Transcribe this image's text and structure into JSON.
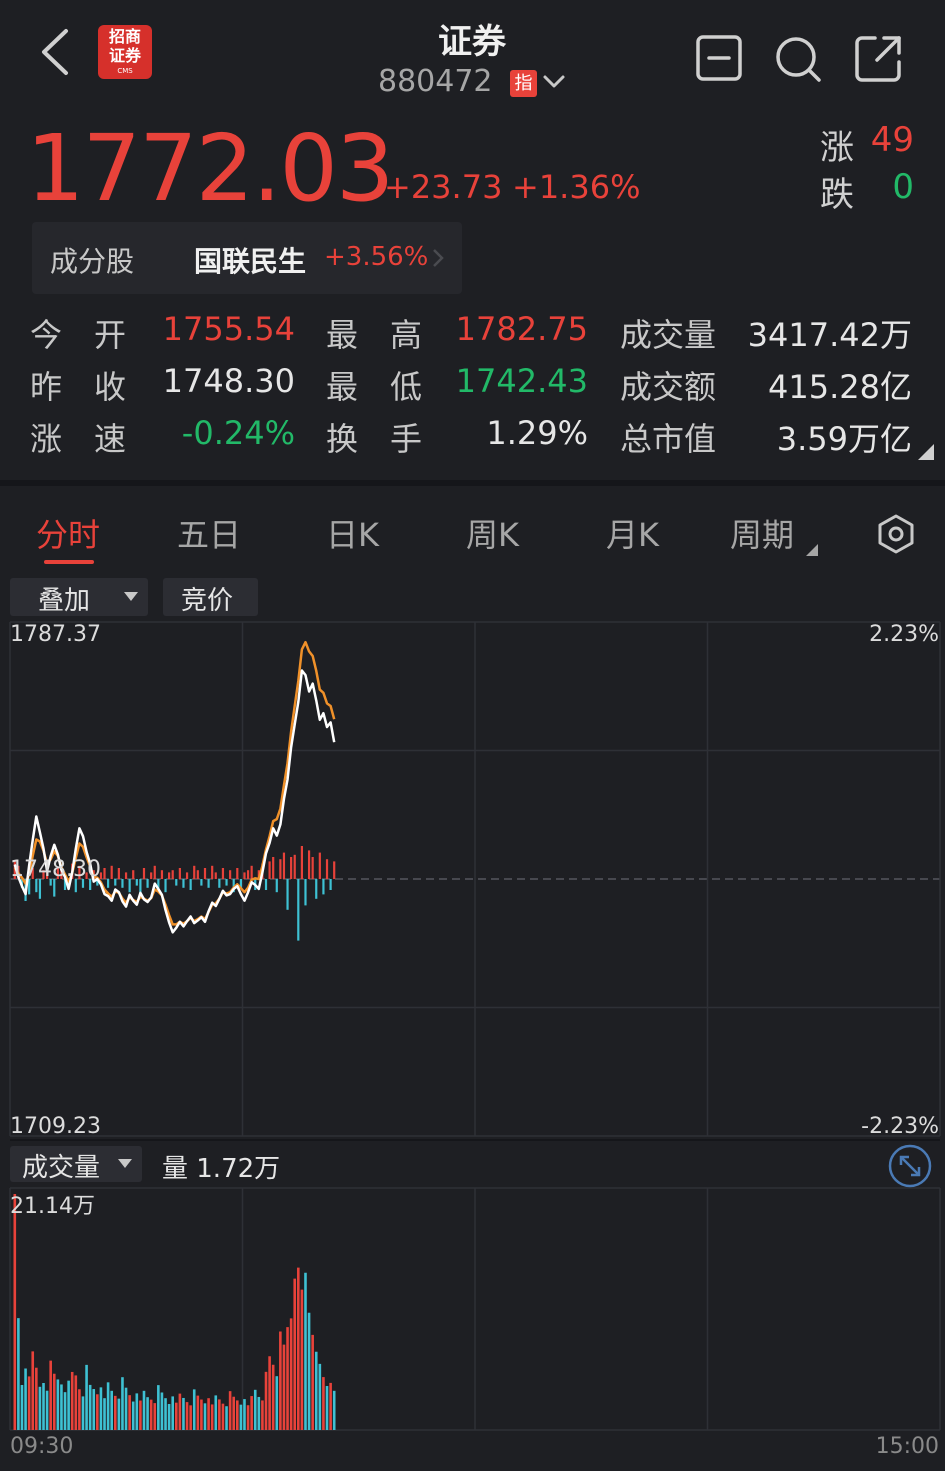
{
  "header": {
    "logo_line1": "招商",
    "logo_line2": "证券",
    "logo_line3": "CMS",
    "title": "证券",
    "code": "880472",
    "index_badge": "指"
  },
  "quote": {
    "price": "1772.03",
    "change": "+23.73",
    "change_pct": "+1.36%",
    "up_label": "涨",
    "up_count": "49",
    "down_label": "跌",
    "down_count": "0"
  },
  "constituent": {
    "label": "成分股",
    "name": "国联民生",
    "pct": "+3.56%"
  },
  "stats": {
    "open_label": "今　开",
    "open": "1755.54",
    "high_label": "最　高",
    "high": "1782.75",
    "volume_label": "成交量",
    "volume": "3417.42万",
    "prev_label": "昨　收",
    "prev": "1748.30",
    "low_label": "最　低",
    "low": "1742.43",
    "amount_label": "成交额",
    "amount": "415.28亿",
    "speed_label": "涨　速",
    "speed": "-0.24%",
    "turnover_label": "换　手",
    "turnover": "1.29%",
    "mktcap_label": "总市值",
    "mktcap": "3.59万亿"
  },
  "tabs": [
    "分时",
    "五日",
    "日K",
    "周K",
    "月K",
    "周期"
  ],
  "toolbar": {
    "overlay": "叠加",
    "auction": "竞价",
    "volume_selector": "成交量",
    "volume_value": "量 1.72万"
  },
  "colors": {
    "up": "#e8423a",
    "down": "#22b968",
    "price_line": "#ffffff",
    "avg_line": "#f0912a",
    "neg_bar": "#3ec1d3"
  },
  "chart_data": {
    "type": "line",
    "y_top": 1787.37,
    "y_bottom": 1709.23,
    "y_mid": 1748.3,
    "pct_top": "2.23%",
    "pct_bottom": "-2.23%",
    "y_top_label": "1787.37",
    "y_bottom_label": "1709.23",
    "y_mid_label": "1748.30",
    "x_start_label": "09:30",
    "x_end_label": "15:00",
    "total_points": 241,
    "price": [
      1750.5,
      1748.6,
      1747.2,
      1746.0,
      1750.3,
      1754.2,
      1757.8,
      1755.4,
      1752.9,
      1749.5,
      1751.8,
      1753.5,
      1752.0,
      1749.7,
      1748.6,
      1746.8,
      1749.3,
      1752.9,
      1756.0,
      1754.8,
      1752.4,
      1750.6,
      1747.9,
      1748.3,
      1747.5,
      1746.0,
      1745.7,
      1745.0,
      1746.7,
      1746.3,
      1744.9,
      1744.1,
      1745.9,
      1745.0,
      1744.4,
      1746.2,
      1745.2,
      1744.8,
      1745.5,
      1747.6,
      1746.8,
      1745.9,
      1743.6,
      1741.7,
      1740.2,
      1740.9,
      1741.8,
      1741.1,
      1741.9,
      1742.6,
      1741.6,
      1742.0,
      1742.5,
      1741.8,
      1743.4,
      1744.7,
      1744.2,
      1745.3,
      1746.5,
      1745.8,
      1746.0,
      1746.8,
      1747.2,
      1746.0,
      1745.0,
      1746.3,
      1747.8,
      1747.4,
      1746.8,
      1749.3,
      1752.2,
      1753.8,
      1756.0,
      1754.9,
      1756.6,
      1760.5,
      1763.4,
      1768.3,
      1771.8,
      1775.2,
      1780.0,
      1779.3,
      1776.8,
      1778.0,
      1775.4,
      1772.5,
      1773.5,
      1771.4,
      1772.1,
      1769.1
    ],
    "average": [
      1750.0,
      1749.2,
      1748.5,
      1747.6,
      1749.0,
      1751.8,
      1754.3,
      1754.0,
      1752.6,
      1750.6,
      1751.3,
      1752.5,
      1751.8,
      1750.1,
      1749.0,
      1747.9,
      1749.2,
      1751.5,
      1753.7,
      1753.2,
      1751.6,
      1750.2,
      1748.6,
      1748.5,
      1747.8,
      1746.7,
      1746.1,
      1745.6,
      1746.4,
      1746.2,
      1745.3,
      1744.7,
      1745.5,
      1745.1,
      1744.8,
      1745.6,
      1745.3,
      1745.0,
      1745.4,
      1746.7,
      1746.4,
      1745.8,
      1744.4,
      1742.8,
      1741.4,
      1741.4,
      1741.8,
      1741.5,
      1741.9,
      1742.4,
      1741.9,
      1742.2,
      1742.6,
      1742.2,
      1743.3,
      1744.4,
      1744.6,
      1745.3,
      1746.3,
      1746.1,
      1746.3,
      1747.0,
      1747.5,
      1746.9,
      1746.3,
      1747.0,
      1748.2,
      1748.4,
      1748.3,
      1750.3,
      1752.8,
      1754.8,
      1757.1,
      1757.4,
      1759.0,
      1762.6,
      1765.9,
      1770.7,
      1774.6,
      1778.4,
      1783.2,
      1784.3,
      1782.9,
      1782.2,
      1779.9,
      1777.1,
      1776.6,
      1775.0,
      1774.6,
      1772.6
    ],
    "trend_bars": [
      8,
      6,
      -4,
      -10,
      -7,
      5,
      -6,
      -9,
      4,
      7,
      -3,
      -8,
      5,
      6,
      -5,
      -4,
      7,
      -6,
      6,
      -4,
      3,
      -5,
      4,
      -3,
      3,
      5,
      -4,
      6,
      -3,
      5,
      -4,
      3,
      -6,
      4,
      -3,
      -8,
      5,
      -4,
      3,
      6,
      -5,
      4,
      -6,
      3,
      4,
      -3,
      5,
      -4,
      3,
      -5,
      6,
      4,
      -3,
      5,
      -4,
      6,
      3,
      -4,
      5,
      -3,
      4,
      -6,
      5,
      -4,
      3,
      4,
      6,
      -5,
      4,
      7,
      -5,
      8,
      10,
      -6,
      9,
      12,
      -14,
      10,
      11,
      -28,
      15,
      -12,
      13,
      10,
      -9,
      12,
      -7,
      9,
      -5,
      8
    ],
    "volume": [
      211400,
      100200,
      40300,
      55100,
      48000,
      70400,
      55800,
      38700,
      42100,
      35200,
      62100,
      50400,
      45300,
      40800,
      33900,
      44200,
      52000,
      48900,
      36500,
      30100,
      58300,
      40400,
      36700,
      32000,
      38200,
      28500,
      42700,
      35100,
      30600,
      28100,
      47300,
      37900,
      31200,
      25500,
      32800,
      26400,
      35100,
      29400,
      27200,
      24100,
      40200,
      33600,
      28500,
      23300,
      30100,
      24500,
      32600,
      28700,
      25000,
      22100,
      36400,
      30800,
      27300,
      23900,
      28500,
      22900,
      31000,
      27400,
      23600,
      21300,
      34800,
      29800,
      26500,
      22700,
      27700,
      22200,
      30400,
      36000,
      29600,
      26500,
      52100,
      66100,
      58400,
      48200,
      88200,
      76500,
      92100,
      100000,
      135600,
      145500,
      125700,
      140900,
      105000,
      85200,
      70100,
      59200,
      47400,
      39400,
      42200,
      35100
    ]
  }
}
